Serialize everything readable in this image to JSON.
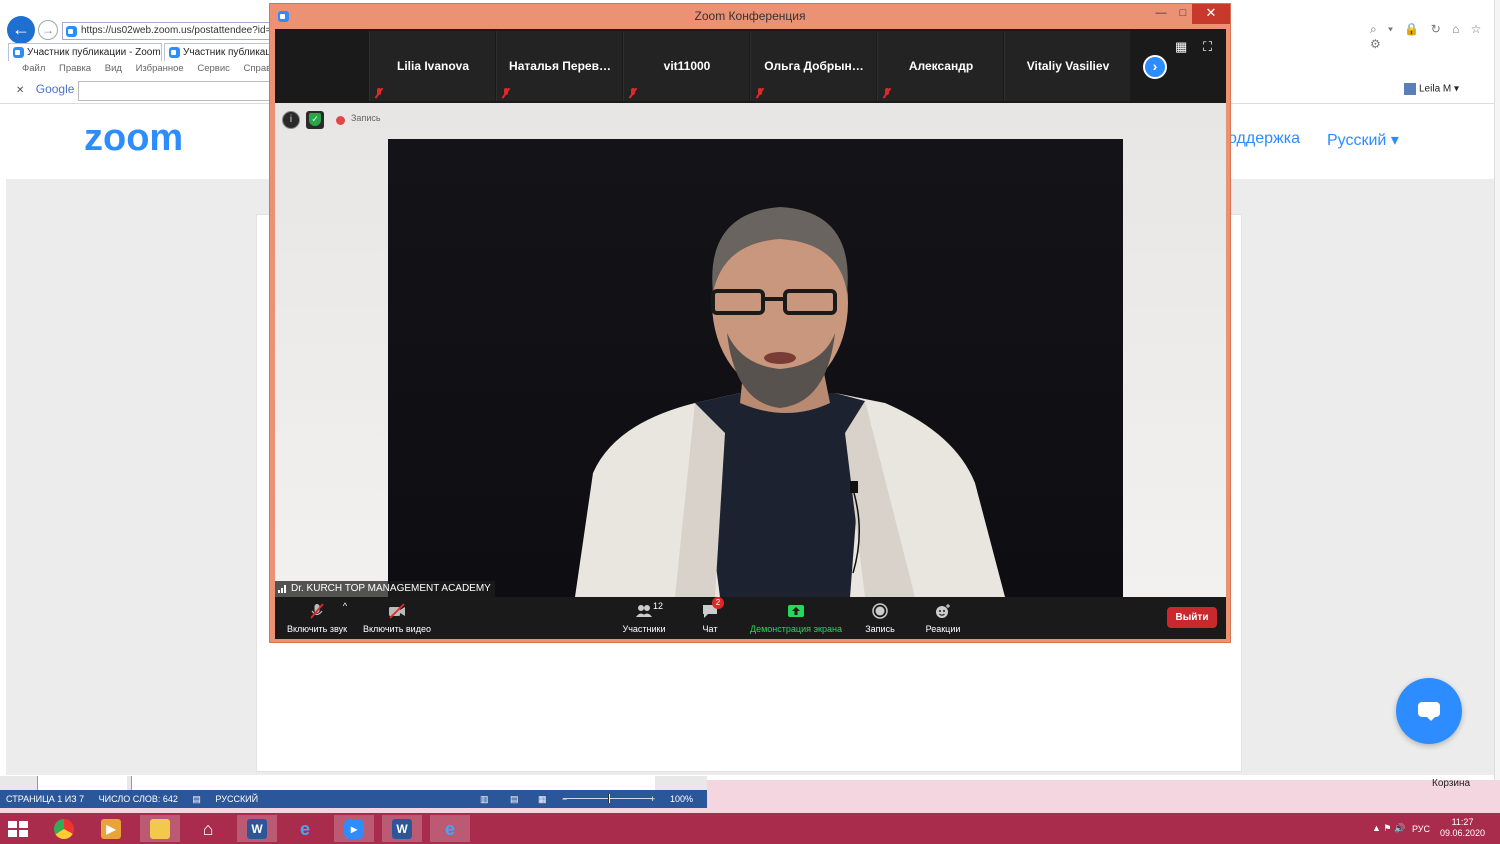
{
  "browser": {
    "address": "https://us02web.zoom.us/postattendee?id=3",
    "tabs": [
      "Участник публикации - Zoom",
      "Участник публикации"
    ],
    "menu": [
      "Файл",
      "Правка",
      "Вид",
      "Избранное",
      "Сервис",
      "Справка"
    ],
    "google_label": "Google",
    "close_x": "✕",
    "right_icons": "⌕ ▾ 🔒 ↻ ⌂ ☆ ⚙",
    "user": "Leila M ▾",
    "back": "←",
    "forward": "→"
  },
  "zoom_site": {
    "logo": "zoom",
    "support": "оддержка",
    "language": "Русский ▾"
  },
  "zoom_window": {
    "title": "Zoom Конференция",
    "minimize": "—",
    "maximize": "□",
    "close": "✕",
    "participants": [
      "Lilia Ivanova",
      "Наталья  Перев…",
      "vit11000",
      "Ольга  Добрын…",
      "Александр",
      "Vitaliy Vasiliev"
    ],
    "next_page": "›",
    "gallery_icon": "▦",
    "fullscreen_icon": "⛶",
    "info_icon": "i",
    "recording_label": "Запись",
    "speaker_name": "Dr. KURCH TOP MANAGEMENT ACADEMY",
    "toolbar": {
      "unmute": "Включить звук",
      "unmute_caret": "^",
      "start_video": "Включить видео",
      "participants": "Участники",
      "participants_count": "12",
      "chat": "Чат",
      "chat_badge": "2",
      "share": "Демонстрация экрана",
      "record": "Запись",
      "reactions": "Реакции",
      "leave": "Выйти"
    }
  },
  "word_status": {
    "page": "СТРАНИЦА 1 ИЗ 7",
    "words": "ЧИСЛО СЛОВ: 642",
    "language": "РУССКИЙ",
    "zoom_level": "100%",
    "zoom_minus": "−",
    "zoom_plus": "+"
  },
  "desktop": {
    "recycle_bin": "Корзина"
  },
  "taskbar": {
    "apps": [
      "chrome",
      "media-player",
      "file-explorer",
      "home",
      "word",
      "internet-explorer",
      "zoom",
      "word",
      "internet-explorer"
    ],
    "tray_icons": "▲ ⚑ 🔊",
    "lang": "РУС",
    "time": "11:27",
    "date": "09.06.2020"
  },
  "colors": {
    "zoom_blue": "#2d8cff",
    "leave_red": "#c7292d",
    "taskbar": "#a92c4c",
    "window_frame": "#ec9274",
    "share_green": "#23d959"
  }
}
